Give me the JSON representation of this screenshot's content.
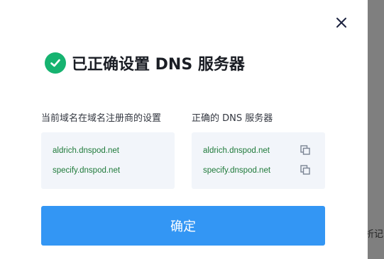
{
  "dialog": {
    "title": "已正确设置 DNS 服务器",
    "current_label": "当前域名在域名注册商的设置",
    "correct_label": "正确的 DNS 服务器",
    "current_servers": [
      "aldrich.dnspod.net",
      "specify.dnspod.net"
    ],
    "correct_servers": [
      "aldrich.dnspod.net",
      "specify.dnspod.net"
    ],
    "ok_label": "确定",
    "icons": {
      "status": "check-circle-icon",
      "close": "close-icon",
      "copy": "copy-icon"
    }
  },
  "background": {
    "partial_text": "析记录"
  },
  "colors": {
    "accent": "#3396f4",
    "success": "#16b370",
    "server_text": "#1f7a3a",
    "box_bg": "#f2f5fa",
    "overlay": "#7f7f7f"
  }
}
